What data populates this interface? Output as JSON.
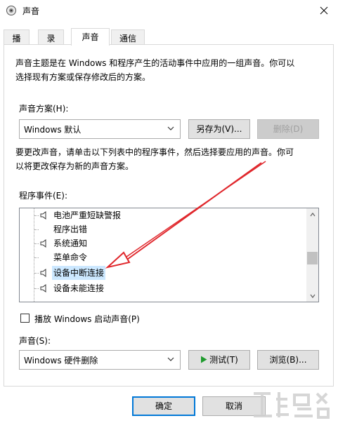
{
  "window": {
    "title": "声音"
  },
  "tabs": [
    {
      "label": "播放"
    },
    {
      "label": "录制"
    },
    {
      "label": "声音"
    },
    {
      "label": "通信"
    }
  ],
  "main": {
    "intro_line1": "声音主题是在 Windows 和程序产生的活动事件中应用的一组声音。你可以",
    "intro_line2": "选择现有方案或保存修改后的方案。",
    "scheme_label": "声音方案(H):",
    "scheme_value": "Windows 默认",
    "save_as_label": "另存为(V)...",
    "delete_label": "删除(D)",
    "instr_line1": "要更改声音，请单击以下列表中的程序事件，然后选择要应用的声音。你可",
    "instr_line2": "以将更改保存为新的声音方案。",
    "events_label": "程序事件(E):",
    "events": [
      {
        "label": "电池严重短缺警报",
        "has_sound": true
      },
      {
        "label": "程序出错",
        "has_sound": false
      },
      {
        "label": "系统通知",
        "has_sound": true
      },
      {
        "label": "菜单命令",
        "has_sound": false
      },
      {
        "label": "设备中断连接",
        "has_sound": true,
        "selected": true
      },
      {
        "label": "设备未能连接",
        "has_sound": true
      }
    ],
    "startup_checkbox_label": "播放 Windows 启动声音(P)",
    "startup_checked": false,
    "sound_label": "声音(S):",
    "sound_value": "Windows 硬件删除",
    "test_label": "测试(T)",
    "browse_label": "浏览(B)..."
  },
  "footer": {
    "ok_label": "确定",
    "cancel_label": "取消"
  },
  "colors": {
    "accent": "#0078d7",
    "selection": "#cce8ff",
    "annotation_arrow": "#e0282d",
    "play_icon": "#1f9b2e"
  },
  "icons": [
    "speaker-icon",
    "close-icon",
    "chevron-down-icon",
    "play-icon"
  ]
}
